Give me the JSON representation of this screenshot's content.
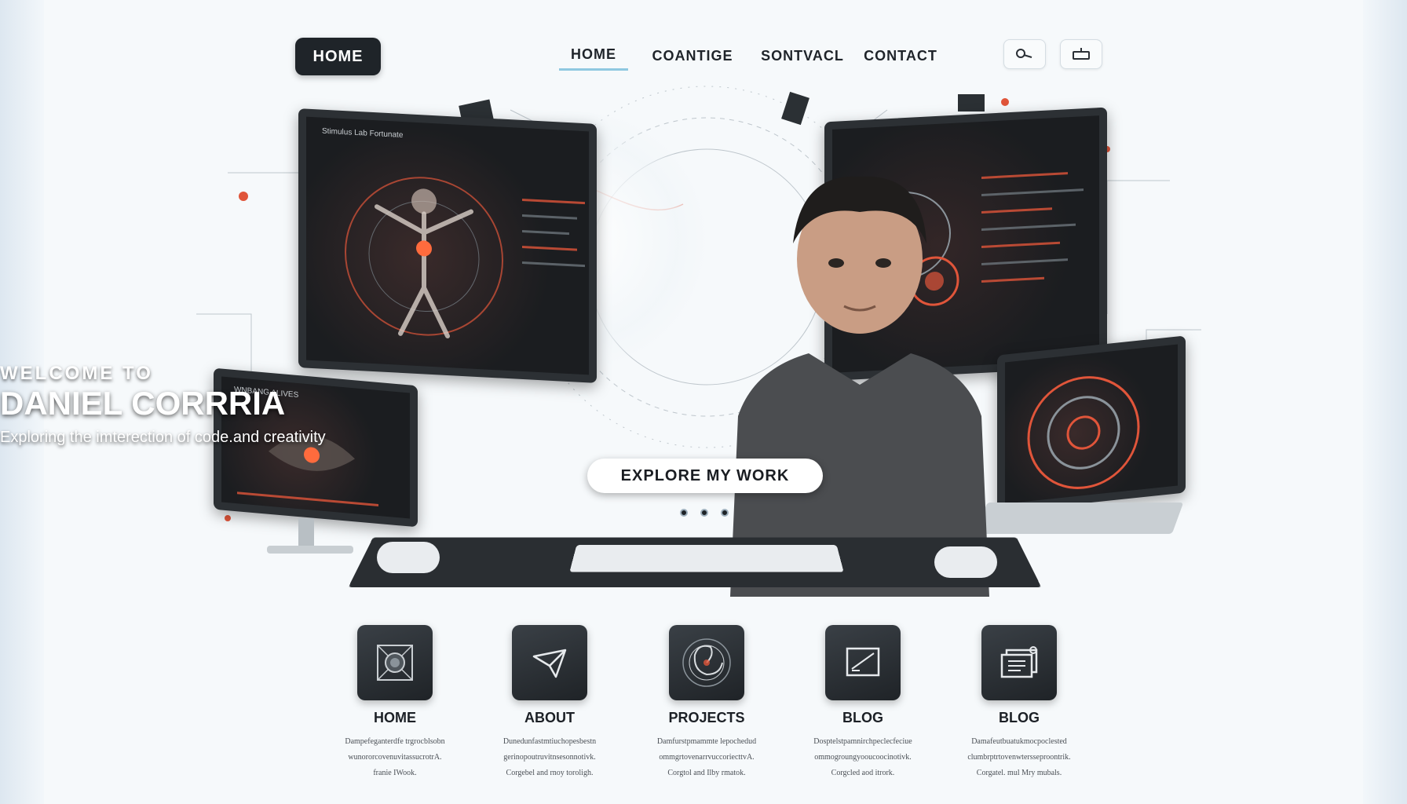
{
  "nav": {
    "logo_label": "HOME",
    "links": [
      "HOME",
      "COANTIGE",
      "SONTVACL",
      "CONTACT"
    ],
    "active_index": 0,
    "search_icon": "search-icon",
    "menu_icon": "tray-icon"
  },
  "hero": {
    "welcome": "WELCOME TO",
    "name": "DANIEL CORRRIA",
    "tagline": "Exploring the imterection of code.and creativity",
    "cta_label": "EXPLORE  MY  WORK",
    "left_screen_title": "Stimulus Lab Fortunate",
    "left_small_screen_title": "WNBANG ALIVES",
    "slide_count": 3
  },
  "features": [
    {
      "label": "HOME",
      "icon": "target-icon",
      "desc": [
        "Dampefeganterdfe trgrocblsobn",
        "wunororcovenuvitassucrotrA.",
        "franie IWook."
      ]
    },
    {
      "label": "ABOUT",
      "icon": "send-icon",
      "desc": [
        "Dunedunfastmtiuchopesbestn",
        "gerinopoutruvitnsesonnotivk.",
        "Corgebel and rnoy toroligh."
      ]
    },
    {
      "label": "PROJECTS",
      "icon": "spiral-icon",
      "desc": [
        "Damfurstpmammte lepochedud",
        "ommgrtovenarrvuccoriecttvA.",
        "Corgtol and Ilby rmatok."
      ]
    },
    {
      "label": "BLOG",
      "icon": "chart-window-icon",
      "desc": [
        "Dosptelstpamnirchpeclecfeciue",
        "ommogroungyooucoocinotivk.",
        "Corgcled aod itrork."
      ]
    },
    {
      "label": "BLOG",
      "icon": "document-icon",
      "desc": [
        "Damafeutbuatukmocpoclested",
        "clumbrptrtovenwtersseproontrik.",
        "Corgatel. mul Mry mubals."
      ]
    }
  ],
  "colors": {
    "accent": "#e0553a",
    "dark_tile": "#23272b",
    "nav_underline": "#8fc8e0",
    "background": "#f6f9fb"
  }
}
